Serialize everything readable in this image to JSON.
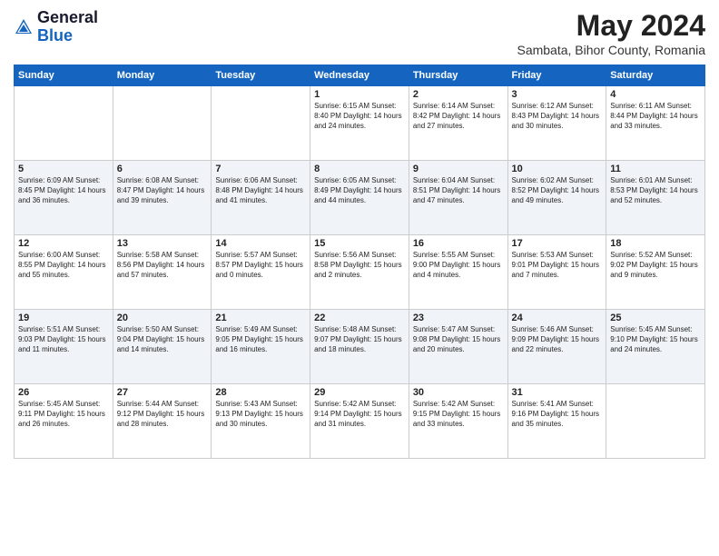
{
  "logo": {
    "general": "General",
    "blue": "Blue"
  },
  "title": "May 2024",
  "subtitle": "Sambata, Bihor County, Romania",
  "days_of_week": [
    "Sunday",
    "Monday",
    "Tuesday",
    "Wednesday",
    "Thursday",
    "Friday",
    "Saturday"
  ],
  "weeks": [
    [
      {
        "day": "",
        "info": ""
      },
      {
        "day": "",
        "info": ""
      },
      {
        "day": "",
        "info": ""
      },
      {
        "day": "1",
        "info": "Sunrise: 6:15 AM\nSunset: 8:40 PM\nDaylight: 14 hours\nand 24 minutes."
      },
      {
        "day": "2",
        "info": "Sunrise: 6:14 AM\nSunset: 8:42 PM\nDaylight: 14 hours\nand 27 minutes."
      },
      {
        "day": "3",
        "info": "Sunrise: 6:12 AM\nSunset: 8:43 PM\nDaylight: 14 hours\nand 30 minutes."
      },
      {
        "day": "4",
        "info": "Sunrise: 6:11 AM\nSunset: 8:44 PM\nDaylight: 14 hours\nand 33 minutes."
      }
    ],
    [
      {
        "day": "5",
        "info": "Sunrise: 6:09 AM\nSunset: 8:45 PM\nDaylight: 14 hours\nand 36 minutes."
      },
      {
        "day": "6",
        "info": "Sunrise: 6:08 AM\nSunset: 8:47 PM\nDaylight: 14 hours\nand 39 minutes."
      },
      {
        "day": "7",
        "info": "Sunrise: 6:06 AM\nSunset: 8:48 PM\nDaylight: 14 hours\nand 41 minutes."
      },
      {
        "day": "8",
        "info": "Sunrise: 6:05 AM\nSunset: 8:49 PM\nDaylight: 14 hours\nand 44 minutes."
      },
      {
        "day": "9",
        "info": "Sunrise: 6:04 AM\nSunset: 8:51 PM\nDaylight: 14 hours\nand 47 minutes."
      },
      {
        "day": "10",
        "info": "Sunrise: 6:02 AM\nSunset: 8:52 PM\nDaylight: 14 hours\nand 49 minutes."
      },
      {
        "day": "11",
        "info": "Sunrise: 6:01 AM\nSunset: 8:53 PM\nDaylight: 14 hours\nand 52 minutes."
      }
    ],
    [
      {
        "day": "12",
        "info": "Sunrise: 6:00 AM\nSunset: 8:55 PM\nDaylight: 14 hours\nand 55 minutes."
      },
      {
        "day": "13",
        "info": "Sunrise: 5:58 AM\nSunset: 8:56 PM\nDaylight: 14 hours\nand 57 minutes."
      },
      {
        "day": "14",
        "info": "Sunrise: 5:57 AM\nSunset: 8:57 PM\nDaylight: 15 hours\nand 0 minutes."
      },
      {
        "day": "15",
        "info": "Sunrise: 5:56 AM\nSunset: 8:58 PM\nDaylight: 15 hours\nand 2 minutes."
      },
      {
        "day": "16",
        "info": "Sunrise: 5:55 AM\nSunset: 9:00 PM\nDaylight: 15 hours\nand 4 minutes."
      },
      {
        "day": "17",
        "info": "Sunrise: 5:53 AM\nSunset: 9:01 PM\nDaylight: 15 hours\nand 7 minutes."
      },
      {
        "day": "18",
        "info": "Sunrise: 5:52 AM\nSunset: 9:02 PM\nDaylight: 15 hours\nand 9 minutes."
      }
    ],
    [
      {
        "day": "19",
        "info": "Sunrise: 5:51 AM\nSunset: 9:03 PM\nDaylight: 15 hours\nand 11 minutes."
      },
      {
        "day": "20",
        "info": "Sunrise: 5:50 AM\nSunset: 9:04 PM\nDaylight: 15 hours\nand 14 minutes."
      },
      {
        "day": "21",
        "info": "Sunrise: 5:49 AM\nSunset: 9:05 PM\nDaylight: 15 hours\nand 16 minutes."
      },
      {
        "day": "22",
        "info": "Sunrise: 5:48 AM\nSunset: 9:07 PM\nDaylight: 15 hours\nand 18 minutes."
      },
      {
        "day": "23",
        "info": "Sunrise: 5:47 AM\nSunset: 9:08 PM\nDaylight: 15 hours\nand 20 minutes."
      },
      {
        "day": "24",
        "info": "Sunrise: 5:46 AM\nSunset: 9:09 PM\nDaylight: 15 hours\nand 22 minutes."
      },
      {
        "day": "25",
        "info": "Sunrise: 5:45 AM\nSunset: 9:10 PM\nDaylight: 15 hours\nand 24 minutes."
      }
    ],
    [
      {
        "day": "26",
        "info": "Sunrise: 5:45 AM\nSunset: 9:11 PM\nDaylight: 15 hours\nand 26 minutes."
      },
      {
        "day": "27",
        "info": "Sunrise: 5:44 AM\nSunset: 9:12 PM\nDaylight: 15 hours\nand 28 minutes."
      },
      {
        "day": "28",
        "info": "Sunrise: 5:43 AM\nSunset: 9:13 PM\nDaylight: 15 hours\nand 30 minutes."
      },
      {
        "day": "29",
        "info": "Sunrise: 5:42 AM\nSunset: 9:14 PM\nDaylight: 15 hours\nand 31 minutes."
      },
      {
        "day": "30",
        "info": "Sunrise: 5:42 AM\nSunset: 9:15 PM\nDaylight: 15 hours\nand 33 minutes."
      },
      {
        "day": "31",
        "info": "Sunrise: 5:41 AM\nSunset: 9:16 PM\nDaylight: 15 hours\nand 35 minutes."
      },
      {
        "day": "",
        "info": ""
      }
    ]
  ]
}
